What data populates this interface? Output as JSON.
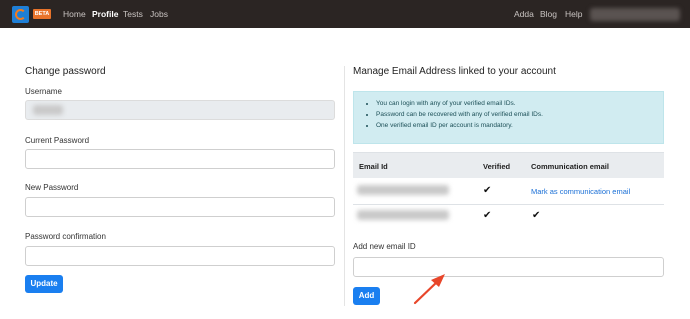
{
  "navbar": {
    "beta": "BETA",
    "links": [
      "Home",
      "Profile",
      "Tests",
      "Jobs"
    ],
    "right_links": [
      "Adda",
      "Blog",
      "Help"
    ]
  },
  "change_password": {
    "title": "Change password",
    "username_label": "Username",
    "current_label": "Current Password",
    "new_label": "New Password",
    "confirm_label": "Password confirmation",
    "update_button": "Update"
  },
  "email": {
    "title": "Manage Email Address linked to your account",
    "info": [
      "You can login with any of your verified email IDs.",
      "Password can be recovered with any of verified email IDs.",
      "One verified email ID per account is mandatory."
    ],
    "table": {
      "headers": [
        "Email Id",
        "Verified",
        "Communication email"
      ],
      "rows": [
        {
          "verified": "✔",
          "communication": "Mark as communication email"
        },
        {
          "verified": "✔",
          "communication": "✔"
        }
      ]
    },
    "add_label": "Add new email ID",
    "add_button": "Add"
  },
  "colors": {
    "navbar": "#2b2523",
    "primary": "#1a7ff0",
    "info_bg": "#d1ecf1",
    "arrow": "#e8462a"
  }
}
